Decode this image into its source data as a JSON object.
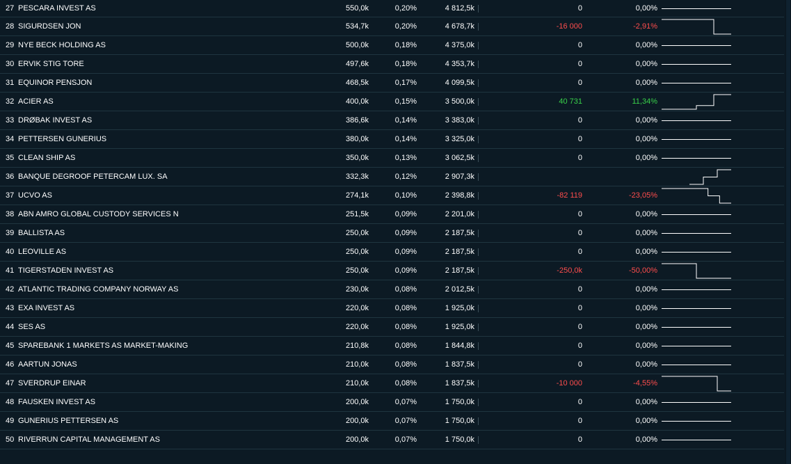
{
  "colors": {
    "negative": "#ff4d4d",
    "positive": "#39d24a",
    "neutral": "#ffffff",
    "background": "#0c1a24",
    "row_border": "#1f3540"
  },
  "rows": [
    {
      "rank": "27",
      "name": "PESCARA INVEST AS",
      "shares": "550,0k",
      "pct": "0,20%",
      "value": "4 812,5k",
      "change": "0",
      "change_pct": "0,00%",
      "trend": "flat",
      "spark": [
        0.5,
        0.5
      ]
    },
    {
      "rank": "28",
      "name": "SIGURDSEN JON",
      "shares": "534,7k",
      "pct": "0,20%",
      "value": "4 678,7k",
      "change": "-16 000",
      "change_pct": "-2,91%",
      "trend": "neg",
      "spark": [
        0.0,
        0.0,
        0.0,
        1.0
      ]
    },
    {
      "rank": "29",
      "name": "NYE BECK HOLDING AS",
      "shares": "500,0k",
      "pct": "0,18%",
      "value": "4 375,0k",
      "change": "0",
      "change_pct": "0,00%",
      "trend": "flat",
      "spark": [
        0.5,
        0.5
      ]
    },
    {
      "rank": "30",
      "name": "ERVIK STIG TORE",
      "shares": "497,6k",
      "pct": "0,18%",
      "value": "4 353,7k",
      "change": "0",
      "change_pct": "0,00%",
      "trend": "flat",
      "spark": [
        0.5,
        0.5
      ]
    },
    {
      "rank": "31",
      "name": "EQUINOR PENSJON",
      "shares": "468,5k",
      "pct": "0,17%",
      "value": "4 099,5k",
      "change": "0",
      "change_pct": "0,00%",
      "trend": "flat",
      "spark": [
        0.5,
        0.5
      ]
    },
    {
      "rank": "32",
      "name": "ACIER AS",
      "shares": "400,0k",
      "pct": "0,15%",
      "value": "3 500,0k",
      "change": "40 731",
      "change_pct": "11,34%",
      "trend": "pos",
      "spark": [
        1.0,
        1.0,
        0.75,
        0.0
      ]
    },
    {
      "rank": "33",
      "name": "DRØBAK INVEST AS",
      "shares": "386,6k",
      "pct": "0,14%",
      "value": "3 383,0k",
      "change": "0",
      "change_pct": "0,00%",
      "trend": "flat",
      "spark": [
        0.5,
        0.5
      ]
    },
    {
      "rank": "34",
      "name": "PETTERSEN GUNERIUS",
      "shares": "380,0k",
      "pct": "0,14%",
      "value": "3 325,0k",
      "change": "0",
      "change_pct": "0,00%",
      "trend": "flat",
      "spark": [
        0.5,
        0.5
      ]
    },
    {
      "rank": "35",
      "name": "CLEAN SHIP AS",
      "shares": "350,0k",
      "pct": "0,13%",
      "value": "3 062,5k",
      "change": "0",
      "change_pct": "0,00%",
      "trend": "flat",
      "spark": [
        0.5,
        0.5
      ]
    },
    {
      "rank": "36",
      "name": "BANQUE DEGROOF PETERCAM LUX. SA",
      "shares": "332,3k",
      "pct": "0,12%",
      "value": "2 907,3k",
      "change": "",
      "change_pct": "",
      "trend": "none",
      "spark": [
        null,
        null,
        1.0,
        0.5,
        0.0
      ]
    },
    {
      "rank": "37",
      "name": "UCVO AS",
      "shares": "274,1k",
      "pct": "0,10%",
      "value": "2 398,8k",
      "change": "-82 119",
      "change_pct": "-23,05%",
      "trend": "neg",
      "spark": [
        0.0,
        0.0,
        0.0,
        0.0,
        0.5,
        1.0
      ]
    },
    {
      "rank": "38",
      "name": "ABN AMRO GLOBAL CUSTODY SERVICES N",
      "shares": "251,5k",
      "pct": "0,09%",
      "value": "2 201,0k",
      "change": "0",
      "change_pct": "0,00%",
      "trend": "flat",
      "spark": [
        0.5,
        0.5
      ]
    },
    {
      "rank": "39",
      "name": "BALLISTA AS",
      "shares": "250,0k",
      "pct": "0,09%",
      "value": "2 187,5k",
      "change": "0",
      "change_pct": "0,00%",
      "trend": "flat",
      "spark": [
        0.5,
        0.5
      ]
    },
    {
      "rank": "40",
      "name": "LEOVILLE AS",
      "shares": "250,0k",
      "pct": "0,09%",
      "value": "2 187,5k",
      "change": "0",
      "change_pct": "0,00%",
      "trend": "flat",
      "spark": [
        0.5,
        0.5
      ]
    },
    {
      "rank": "41",
      "name": "TIGERSTADEN INVEST AS",
      "shares": "250,0k",
      "pct": "0,09%",
      "value": "2 187,5k",
      "change": "-250,0k",
      "change_pct": "-50,00%",
      "trend": "neg",
      "spark": [
        0.0,
        0.0,
        1.0,
        1.0
      ]
    },
    {
      "rank": "42",
      "name": "ATLANTIC TRADING COMPANY NORWAY AS",
      "shares": "230,0k",
      "pct": "0,08%",
      "value": "2 012,5k",
      "change": "0",
      "change_pct": "0,00%",
      "trend": "flat",
      "spark": [
        0.5,
        0.5
      ]
    },
    {
      "rank": "43",
      "name": "EXA INVEST AS",
      "shares": "220,0k",
      "pct": "0,08%",
      "value": "1 925,0k",
      "change": "0",
      "change_pct": "0,00%",
      "trend": "flat",
      "spark": [
        0.5,
        0.5
      ]
    },
    {
      "rank": "44",
      "name": "SES AS",
      "shares": "220,0k",
      "pct": "0,08%",
      "value": "1 925,0k",
      "change": "0",
      "change_pct": "0,00%",
      "trend": "flat",
      "spark": [
        0.5,
        0.5
      ]
    },
    {
      "rank": "45",
      "name": "SPAREBANK 1 MARKETS AS MARKET-MAKING",
      "shares": "210,8k",
      "pct": "0,08%",
      "value": "1 844,8k",
      "change": "0",
      "change_pct": "0,00%",
      "trend": "flat",
      "spark": [
        0.5,
        0.5
      ]
    },
    {
      "rank": "46",
      "name": "AARTUN JONAS",
      "shares": "210,0k",
      "pct": "0,08%",
      "value": "1 837,5k",
      "change": "0",
      "change_pct": "0,00%",
      "trend": "flat",
      "spark": [
        0.5,
        0.5
      ]
    },
    {
      "rank": "47",
      "name": "SVERDRUP EINAR",
      "shares": "210,0k",
      "pct": "0,08%",
      "value": "1 837,5k",
      "change": "-10 000",
      "change_pct": "-4,55%",
      "trend": "neg",
      "spark": [
        0.0,
        0.0,
        0.0,
        0.0,
        1.0
      ]
    },
    {
      "rank": "48",
      "name": "FAUSKEN INVEST AS",
      "shares": "200,0k",
      "pct": "0,07%",
      "value": "1 750,0k",
      "change": "0",
      "change_pct": "0,00%",
      "trend": "flat",
      "spark": [
        0.5,
        0.5
      ]
    },
    {
      "rank": "49",
      "name": "GUNERIUS PETTERSEN AS",
      "shares": "200,0k",
      "pct": "0,07%",
      "value": "1 750,0k",
      "change": "0",
      "change_pct": "0,00%",
      "trend": "flat",
      "spark": [
        0.5,
        0.5
      ]
    },
    {
      "rank": "50",
      "name": "RIVERRUN CAPITAL MANAGEMENT AS",
      "shares": "200,0k",
      "pct": "0,07%",
      "value": "1 750,0k",
      "change": "0",
      "change_pct": "0,00%",
      "trend": "flat",
      "spark": [
        0.5,
        0.5
      ]
    }
  ]
}
